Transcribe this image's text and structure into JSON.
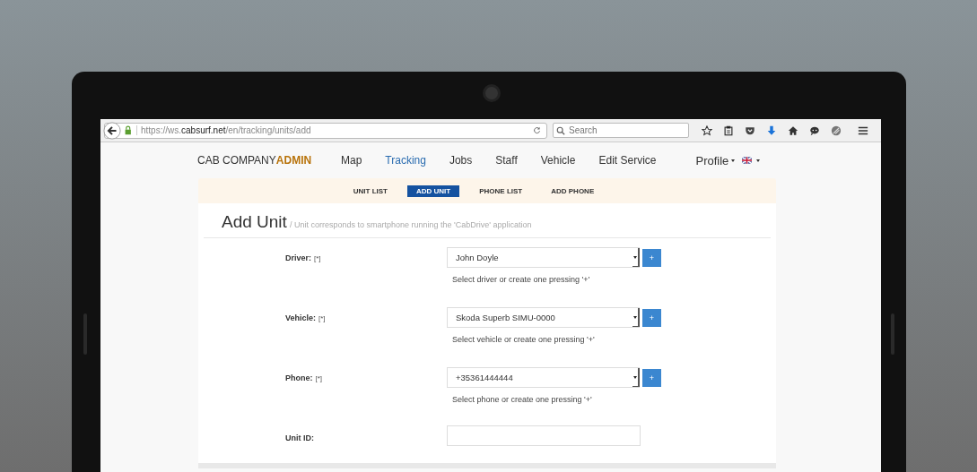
{
  "browser": {
    "url": "https://ws.**cabsurf.net**/en/tracking/units/add",
    "search": {
      "placeholder": "Search"
    }
  },
  "navbar": {
    "brand": "CAB COMPANY**ADMIN**",
    "items": [
      {
        "label": "Map",
        "selected": false
      },
      {
        "label": "Tracking",
        "selected": true
      },
      {
        "label": "Jobs",
        "selected": false
      },
      {
        "label": "Staff",
        "selected": false
      },
      {
        "label": "Vehicle",
        "selected": false
      },
      {
        "label": "Edit Service",
        "selected": false
      }
    ],
    "profile": "Profile"
  },
  "subnav": [
    {
      "label": "UNIT LIST",
      "selected": false
    },
    {
      "label": "ADD UNIT",
      "selected": true
    },
    {
      "label": "PHONE LIST",
      "selected": false
    },
    {
      "label": "ADD PHONE",
      "selected": false
    }
  ],
  "page": {
    "title": "Add Unit",
    "subtitle": "/ Unit corresponds to smartphone running the 'CabDrive' application"
  },
  "form": [
    {
      "kind": "select",
      "label": "Driver:",
      "required": "[*]",
      "value": "John Doyle",
      "button": "+",
      "help": "Select driver or create one pressing '+'"
    },
    {
      "kind": "select",
      "label": "Vehicle:",
      "required": "[*]",
      "value": "Skoda Superb SIMU-0000",
      "button": "+",
      "help": "Select vehicle or create one pressing '+'"
    },
    {
      "kind": "select",
      "label": "Phone:",
      "required": "[*]",
      "value": "+35361444444",
      "button": "+",
      "help": "Select phone or create one pressing '+'"
    },
    {
      "kind": "text",
      "label": "Unit ID:"
    }
  ]
}
